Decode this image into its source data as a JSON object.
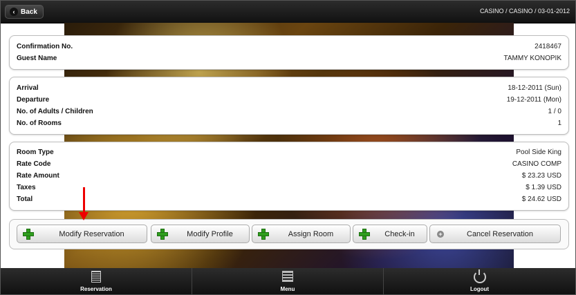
{
  "header": {
    "back_label": "Back",
    "breadcrumb": "CASINO / CASINO / 03-01-2012"
  },
  "guest": {
    "confirmation_label": "Confirmation No.",
    "confirmation_value": "2418467",
    "name_label": "Guest Name",
    "name_value": "TAMMY KONOPIK"
  },
  "stay": {
    "arrival_label": "Arrival",
    "arrival_value": "18-12-2011 (Sun)",
    "departure_label": "Departure",
    "departure_value": "19-12-2011 (Mon)",
    "guests_label": "No. of Adults / Children",
    "guests_value": "1 / 0",
    "rooms_label": "No. of Rooms",
    "rooms_value": "1"
  },
  "rate": {
    "room_type_label": "Room Type",
    "room_type_value": "Pool Side King",
    "rate_code_label": "Rate Code",
    "rate_code_value": "CASINO COMP",
    "rate_amount_label": "Rate Amount",
    "rate_amount_value": "$ 23.23 USD",
    "taxes_label": "Taxes",
    "taxes_value": "$ 1.39 USD",
    "total_label": "Total",
    "total_value": "$ 24.62 USD"
  },
  "actions": {
    "modify_reservation": "Modify Reservation",
    "modify_profile": "Modify Profile",
    "assign_room": "Assign Room",
    "check_in": "Check-in",
    "cancel_reservation": "Cancel Reservation"
  },
  "footer": {
    "reservation": "Reservation",
    "menu": "Menu",
    "logout": "Logout"
  },
  "colors": {
    "plus_icon": "#2f9e1e",
    "annotation_arrow": "#ee0000"
  }
}
